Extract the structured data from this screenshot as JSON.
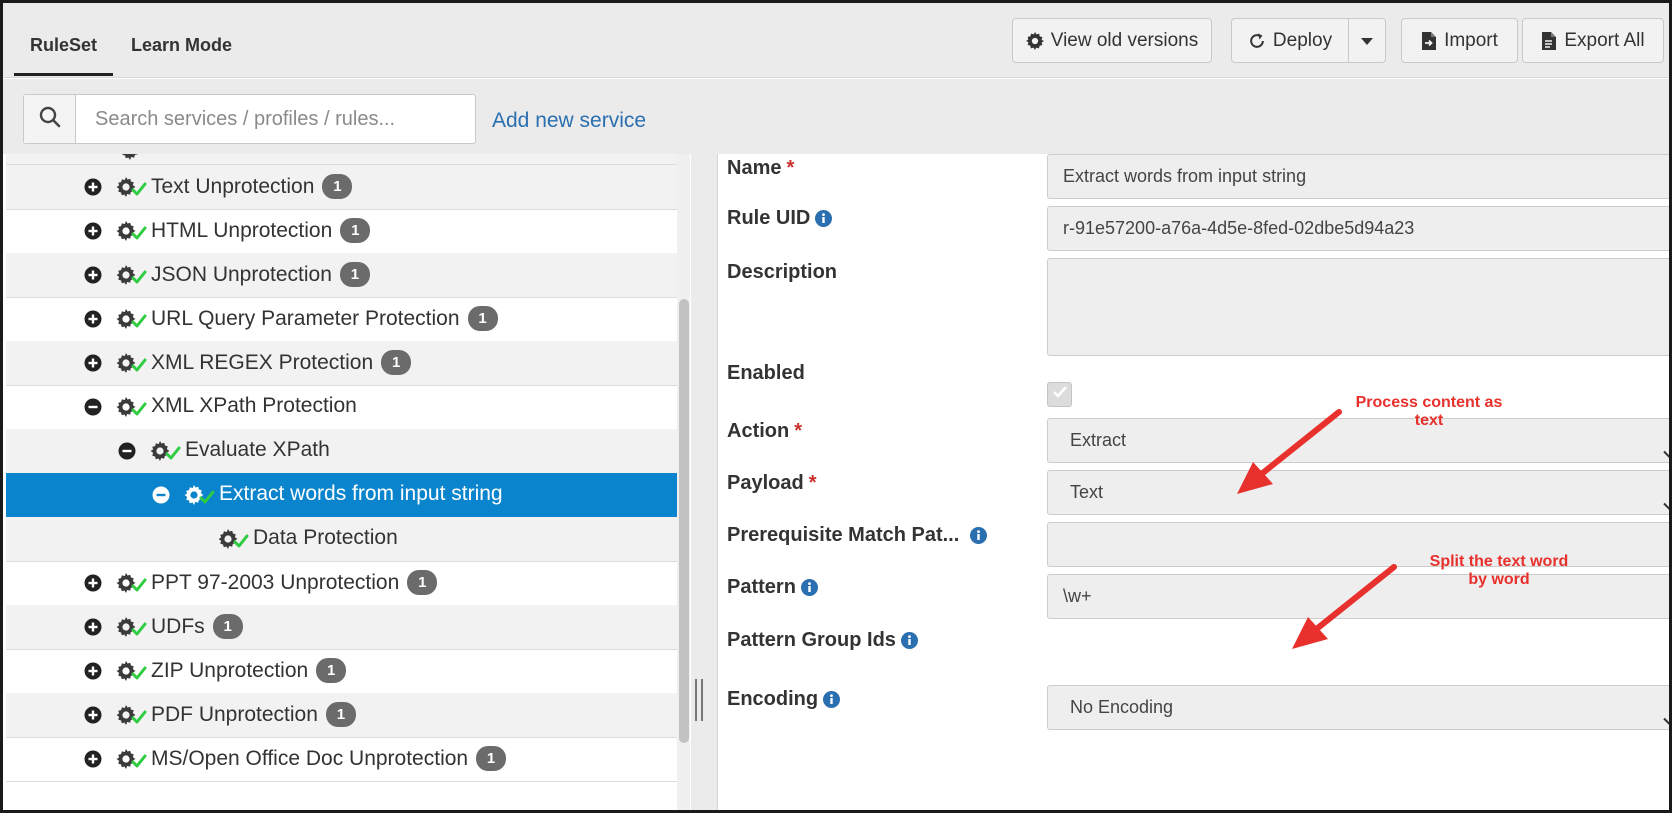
{
  "tabs": [
    {
      "label": "RuleSet",
      "active": true
    },
    {
      "label": "Learn Mode",
      "active": false
    }
  ],
  "toolbar": {
    "view_old_versions": "View old versions",
    "deploy": "Deploy",
    "import": "Import",
    "export_all": "Export All"
  },
  "search": {
    "placeholder": "Search services / profiles / rules...",
    "add_link": "Add new service"
  },
  "tree": {
    "rows": [
      {
        "label": "Text Unprotection",
        "badge": "1"
      },
      {
        "label": "HTML Unprotection",
        "badge": "1"
      },
      {
        "label": "JSON Unprotection",
        "badge": "1"
      },
      {
        "label": "URL Query Parameter Protection",
        "badge": "1"
      },
      {
        "label": "XML REGEX Protection",
        "badge": "1"
      },
      {
        "label": "XML XPath Protection"
      },
      {
        "label": "Evaluate XPath"
      },
      {
        "label": "Extract words from input string",
        "selected": true
      },
      {
        "label": "Data Protection"
      },
      {
        "label": "PPT 97-2003 Unprotection",
        "badge": "1"
      },
      {
        "label": "UDFs",
        "badge": "1"
      },
      {
        "label": "ZIP Unprotection",
        "badge": "1"
      },
      {
        "label": "PDF Unprotection",
        "badge": "1"
      },
      {
        "label": "MS/Open Office Doc Unprotection",
        "badge": "1"
      }
    ]
  },
  "form": {
    "name_label": "Name",
    "name_value": "Extract words from input string",
    "uid_label": "Rule UID",
    "uid_value": "r-91e57200-a76a-4d5e-8fed-02dbe5d94a23",
    "description_label": "Description",
    "description_value": "",
    "enabled_label": "Enabled",
    "enabled_checked": true,
    "action_label": "Action",
    "action_value": "Extract",
    "payload_label": "Payload",
    "payload_value": "Text",
    "prereq_label": "Prerequisite Match Pat...",
    "prereq_value": "",
    "pattern_label": "Pattern",
    "pattern_value": "\\w+",
    "pattern_group_label": "Pattern Group Ids",
    "encoding_label": "Encoding",
    "encoding_value": "No Encoding",
    "required_mark": "*"
  },
  "annotations": {
    "process_line1": "Process content as",
    "process_line2": "text",
    "split_line1": "Split the text word",
    "split_line2": "by word"
  },
  "colors": {
    "selected_row": "#0a84cc",
    "annotation": "#e8302c",
    "link": "#2a6fb0",
    "check": "#2ecc40"
  }
}
